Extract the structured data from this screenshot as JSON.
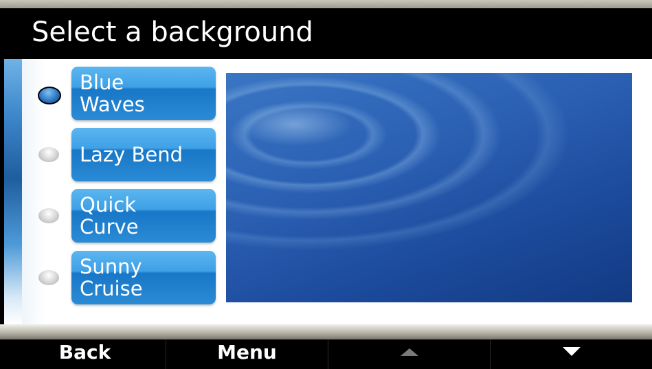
{
  "title": "Select a background",
  "options": [
    {
      "line1": "Blue",
      "line2": "Waves",
      "selected": true
    },
    {
      "line1": "Lazy Bend",
      "line2": "",
      "selected": false
    },
    {
      "line1": "Quick",
      "line2": "Curve",
      "selected": false
    },
    {
      "line1": "Sunny",
      "line2": "Cruise",
      "selected": false
    }
  ],
  "softkeys": {
    "back": "Back",
    "menu": "Menu",
    "up_icon": "arrow-up-icon",
    "down_icon": "arrow-down-icon"
  },
  "colors": {
    "button_blue": "#3ea0e6",
    "title_bg": "#000000",
    "panel_bg": "#ffffff"
  }
}
